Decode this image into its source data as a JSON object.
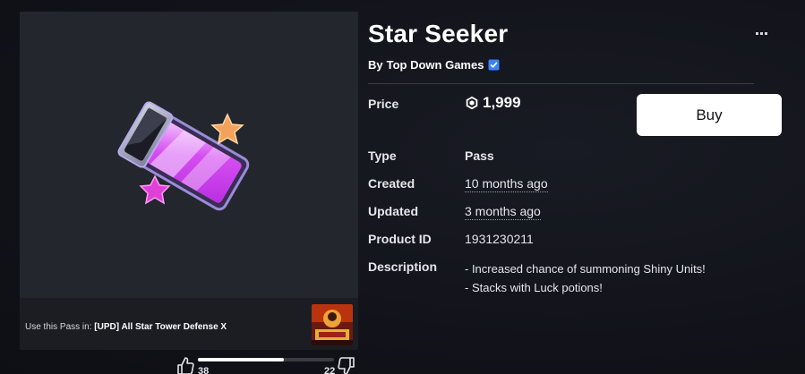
{
  "item": {
    "title": "Star Seeker",
    "by_prefix": "By",
    "creator": "Top Down Games",
    "more_icon": "more-dots-icon"
  },
  "purchase": {
    "price_label": "Price",
    "price": "1,999",
    "buy_label": "Buy"
  },
  "details": {
    "type_label": "Type",
    "type": "Pass",
    "created_label": "Created",
    "created": "10 months ago",
    "updated_label": "Updated",
    "updated": "3 months ago",
    "product_id_label": "Product ID",
    "product_id": "1931230211",
    "description_label": "Description",
    "description_lines": [
      "- Increased chance of summoning Shiny Units!",
      "- Stacks with Luck potions!"
    ]
  },
  "usage": {
    "prefix": "Use this Pass in:",
    "game": "[UPD] All Star Tower Defense X"
  },
  "votes": {
    "up": "38",
    "down": "22",
    "up_fraction": 0.633
  },
  "colors": {
    "background": "#111218",
    "panel": "#24262d",
    "buy_button": "#ffffff",
    "verified_badge": "#3b82f6"
  }
}
